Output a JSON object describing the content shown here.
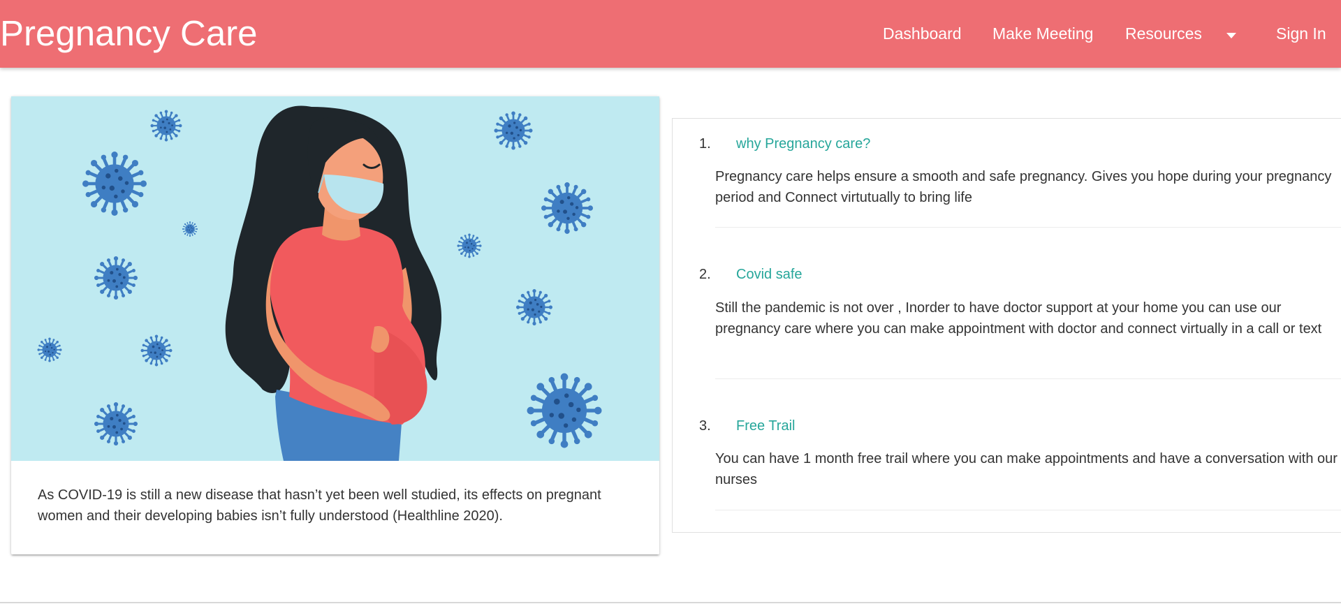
{
  "header": {
    "brand": "Pregnancy Care",
    "nav": {
      "dashboard": "Dashboard",
      "make_meeting": "Make Meeting",
      "resources": "Resources",
      "sign_in": "Sign In"
    },
    "background_color": "#ee6e73"
  },
  "card": {
    "illustration": "pregnant woman wearing face mask surrounded by virus particles",
    "caption": "As COVID-19 is still a new disease that hasn’t yet been well studied, its effects on pregnant women and their developing babies isn’t fully understood (Healthline 2020)."
  },
  "list": {
    "items": [
      {
        "number": "1.",
        "title": "why Pregnancy care?",
        "body": "Pregnancy care helps ensure a smooth and safe pregnancy. Gives you hope during your pregnancy period and Connect virtutually to bring life"
      },
      {
        "number": "2.",
        "title": "Covid safe",
        "body": "Still the pandemic is not over , Inorder to have doctor support at your home you can use our pregnancy care where you can make appointment with doctor and connect virtually in a call or text"
      },
      {
        "number": "3.",
        "title": "Free Trail",
        "body": "You can have 1 month free trail where you can make appointments and have a conversation with our nurses"
      }
    ],
    "title_color": "#26a69a"
  },
  "icons": {
    "resources_dropdown": "caret-down-icon",
    "virus": "virus-icon"
  }
}
